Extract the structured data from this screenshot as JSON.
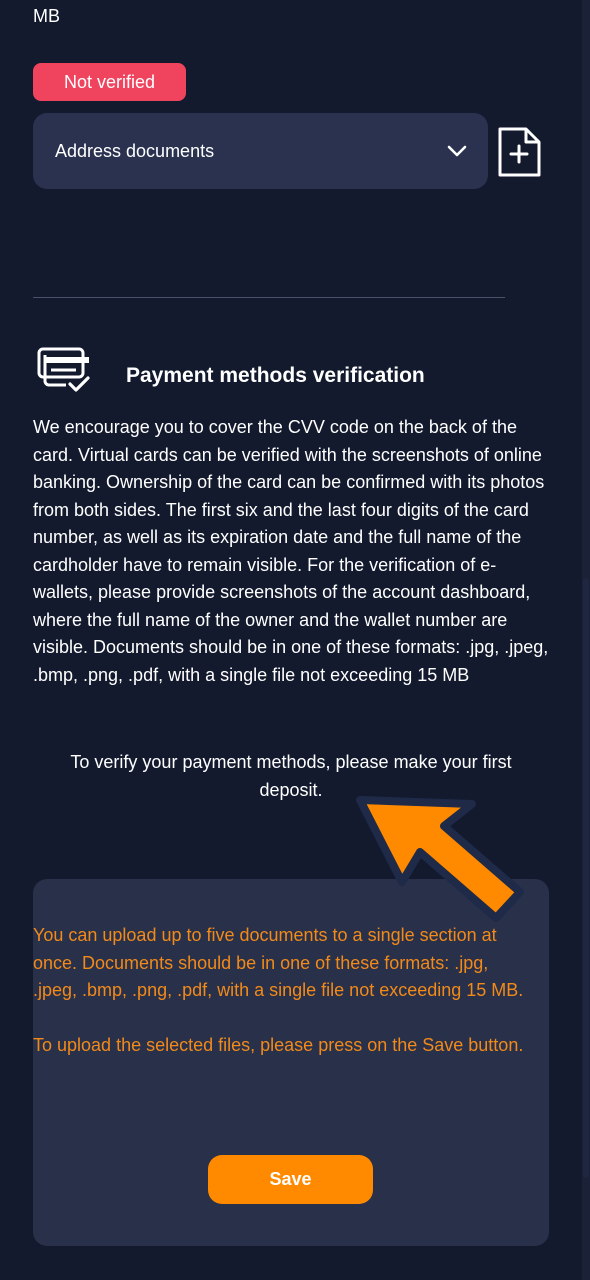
{
  "top": {
    "mb_text": "MB"
  },
  "status": {
    "badge": "Not verified",
    "badge_color": "#f0445e"
  },
  "address_select": {
    "value": "Address documents",
    "icons": [
      "chevron-down-icon",
      "file-plus-icon"
    ]
  },
  "payment_section": {
    "icon": "credit-cards-check-icon",
    "title": "Payment methods verification",
    "description": "We encourage you to cover the CVV code on the back of the card. Virtual cards can be verified with the screenshots of online banking. Ownership of the card can be confirmed with its photos from both sides. The first six and the last four digits of the card number, as well as its expiration date and the full name of the cardholder have to remain visible. For the verification of e-wallets, please provide screenshots of the account dashboard, where the full name of the owner and the wallet number are visible. Documents should be in one of these formats: .jpg, .jpeg, .bmp, .png, .pdf, with a single file not exceeding 15 MB",
    "notice": "To verify your payment methods, please make your first deposit."
  },
  "upload_panel": {
    "info": "You can upload up to five documents to a single section at once. Documents should be in one of these formats: .jpg, .jpeg, .bmp, .png, .pdf, with a single file not exceeding 15 MB.",
    "hint": "To upload the selected files, please press on the Save button.",
    "save_label": "Save",
    "accent_color": "#ff8a00"
  }
}
